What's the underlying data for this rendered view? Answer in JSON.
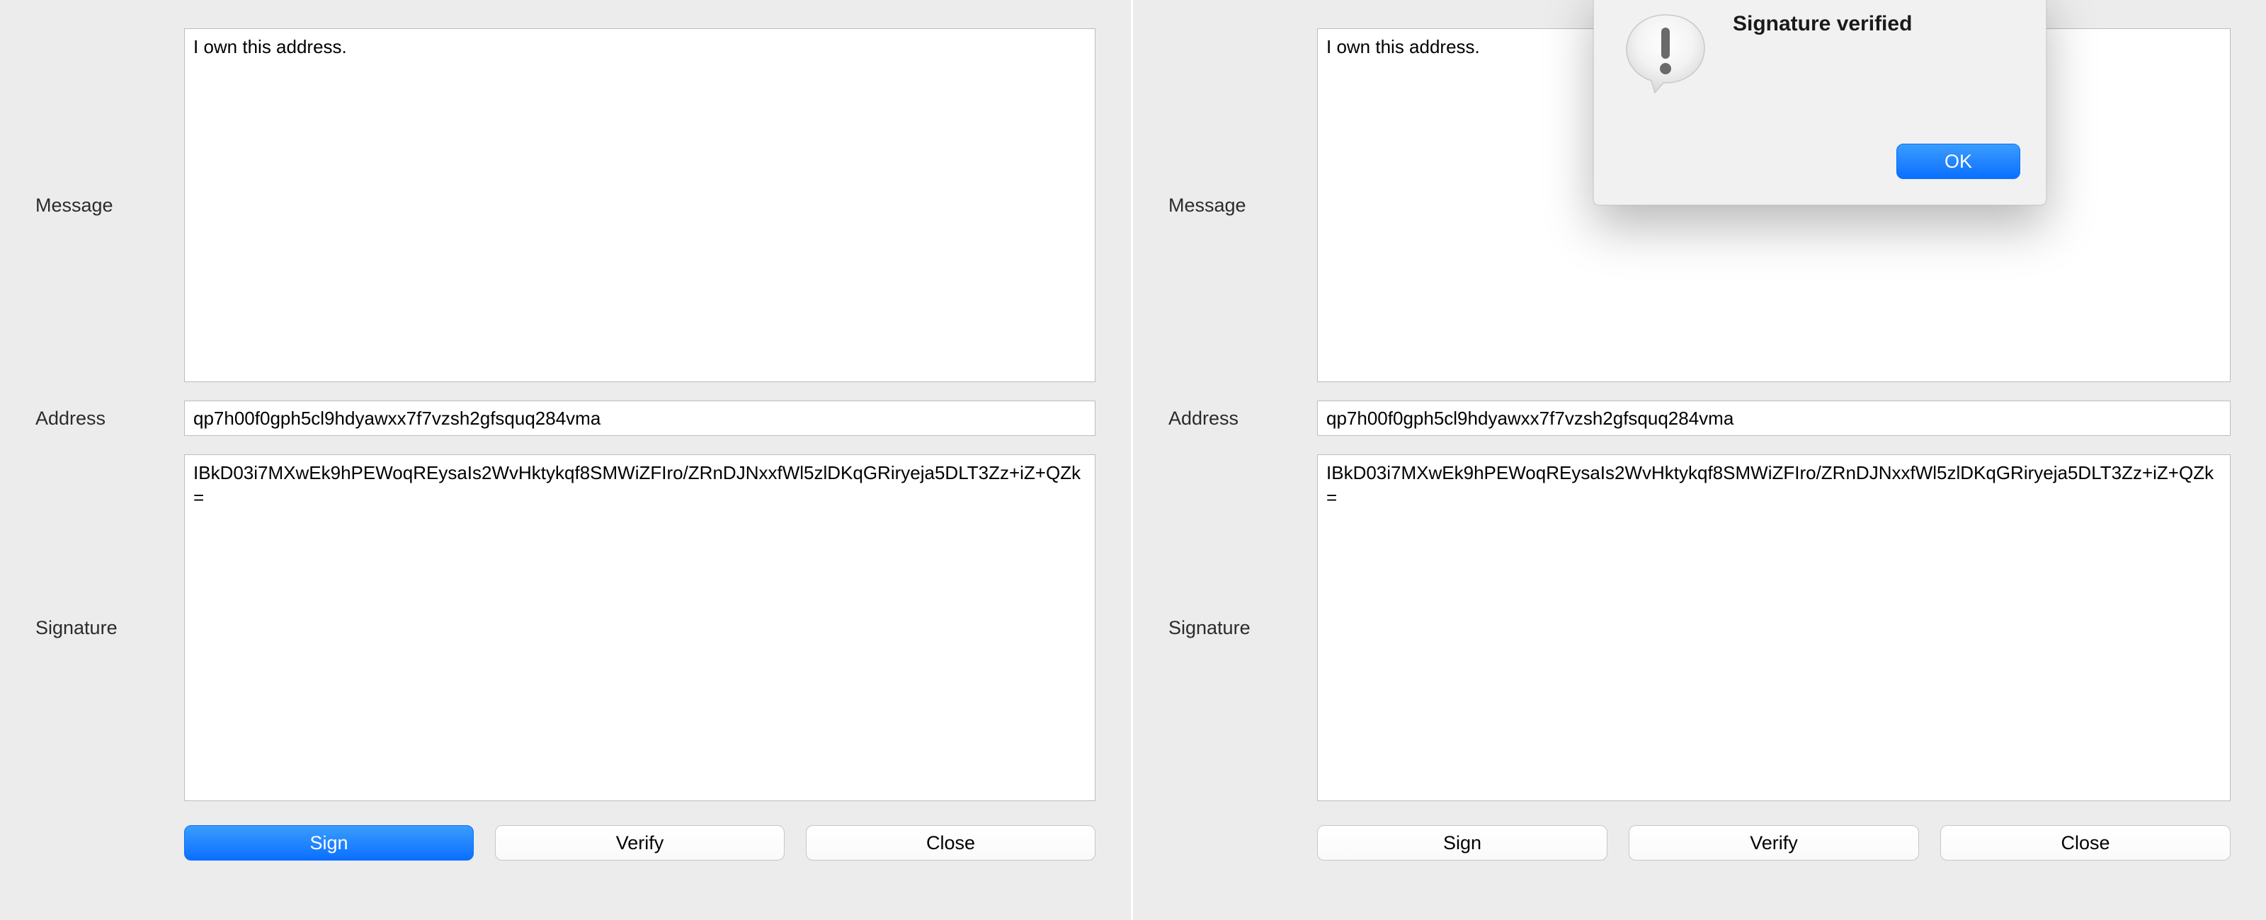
{
  "labels": {
    "message": "Message",
    "address": "Address",
    "signature": "Signature"
  },
  "buttons": {
    "sign": "Sign",
    "verify": "Verify",
    "close": "Close",
    "ok": "OK"
  },
  "left": {
    "message_value": "I own this address.",
    "address_value": "qp7h00f0gph5cl9hdyawxx7f7vzsh2gfsquq284vma",
    "signature_value": "IBkD03i7MXwEk9hPEWoqREysaIs2WvHktykqf8SMWiZFIro/ZRnDJNxxfWl5zlDKqGRiryeja5DLT3Zz+iZ+QZk=",
    "sign_primary": true
  },
  "right": {
    "message_value": "I own this address.",
    "address_value": "qp7h00f0gph5cl9hdyawxx7f7vzsh2gfsquq284vma",
    "signature_value": "IBkD03i7MXwEk9hPEWoqREysaIs2WvHktykqf8SMWiZFIro/ZRnDJNxxfWl5zlDKqGRiryeja5DLT3Zz+iZ+QZk=",
    "alert": {
      "title": "Signature verified"
    }
  }
}
